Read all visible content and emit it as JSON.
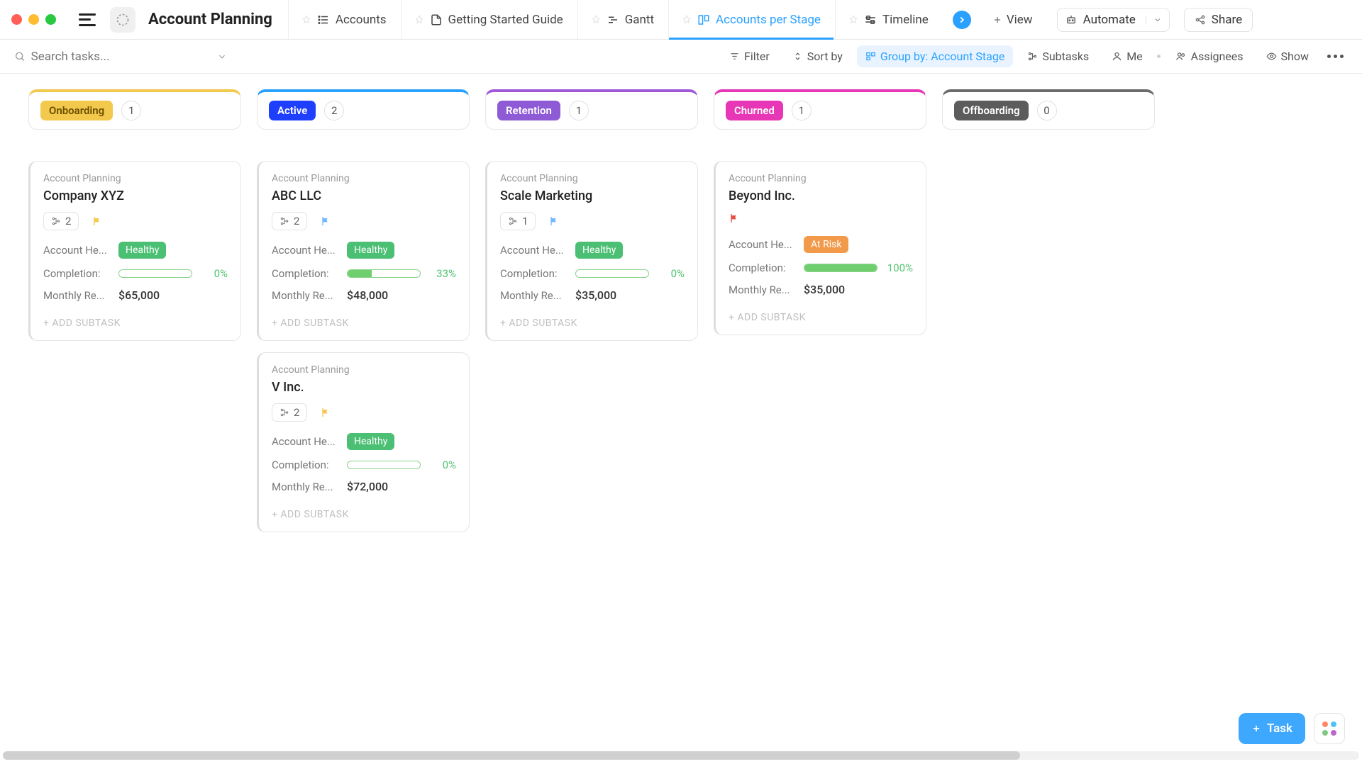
{
  "header": {
    "page_title": "Account Planning",
    "tabs": [
      {
        "label": "Accounts",
        "active": false,
        "icon": "list"
      },
      {
        "label": "Getting Started Guide",
        "active": false,
        "icon": "doc"
      },
      {
        "label": "Gantt",
        "active": false,
        "icon": "gantt"
      },
      {
        "label": "Accounts per Stage",
        "active": true,
        "icon": "board"
      },
      {
        "label": "Timeline",
        "active": false,
        "icon": "timeline"
      }
    ],
    "view_label": "View",
    "automate_label": "Automate",
    "share_label": "Share"
  },
  "toolbar": {
    "search_placeholder": "Search tasks...",
    "filter_label": "Filter",
    "sort_label": "Sort by",
    "group_label": "Group by: Account Stage",
    "subtasks_label": "Subtasks",
    "me_label": "Me",
    "assignees_label": "Assignees",
    "show_label": "Show"
  },
  "board": {
    "crumb_label": "Account Planning",
    "health_label": "Account He...",
    "completion_label": "Completion:",
    "revenue_label": "Monthly Re...",
    "add_subtask_label": "+ ADD SUBTASK",
    "columns": [
      {
        "stage": "Onboarding",
        "pill_class": "pill-onboarding",
        "header_class": "col-onboarding",
        "count": "1",
        "cards": [
          {
            "title": "Company XYZ",
            "subtasks": "2",
            "flag": "yellow",
            "health": "Healthy",
            "health_class": "health-healthy",
            "completion": "0%",
            "completion_pct": 0,
            "revenue": "$65,000"
          }
        ]
      },
      {
        "stage": "Active",
        "pill_class": "pill-active",
        "header_class": "col-active",
        "count": "2",
        "cards": [
          {
            "title": "ABC LLC",
            "subtasks": "2",
            "flag": "blue",
            "health": "Healthy",
            "health_class": "health-healthy",
            "completion": "33%",
            "completion_pct": 33,
            "revenue": "$48,000"
          },
          {
            "title": "V Inc.",
            "subtasks": "2",
            "flag": "yellow",
            "health": "Healthy",
            "health_class": "health-healthy",
            "completion": "0%",
            "completion_pct": 0,
            "revenue": "$72,000"
          }
        ]
      },
      {
        "stage": "Retention",
        "pill_class": "pill-retention",
        "header_class": "col-retention",
        "count": "1",
        "cards": [
          {
            "title": "Scale Marketing",
            "subtasks": "1",
            "flag": "blue",
            "health": "Healthy",
            "health_class": "health-healthy",
            "completion": "0%",
            "completion_pct": 0,
            "revenue": "$35,000"
          }
        ]
      },
      {
        "stage": "Churned",
        "pill_class": "pill-churned",
        "header_class": "col-churned",
        "count": "1",
        "cards": [
          {
            "title": "Beyond Inc.",
            "subtasks": null,
            "flag": "red",
            "health": "At Risk",
            "health_class": "health-atrisk",
            "completion": "100%",
            "completion_pct": 100,
            "revenue": "$35,000"
          }
        ]
      },
      {
        "stage": "Offboarding",
        "pill_class": "pill-offboarding",
        "header_class": "col-offboarding",
        "count": "0",
        "cards": []
      }
    ]
  },
  "fab": {
    "task_label": "Task"
  }
}
